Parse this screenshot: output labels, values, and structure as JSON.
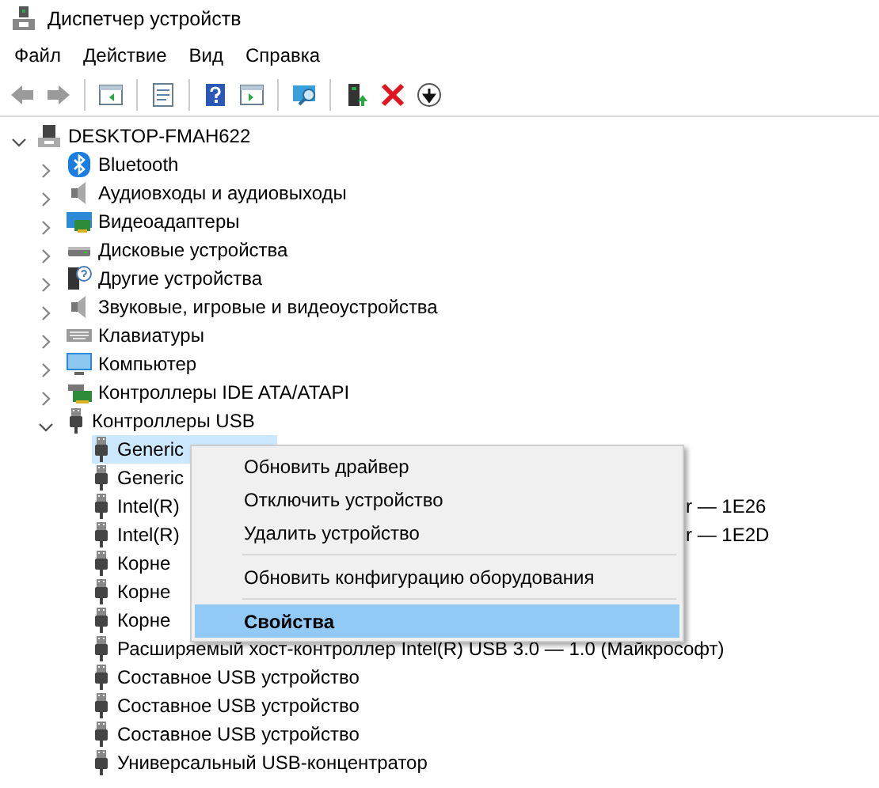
{
  "window": {
    "title": "Диспетчер устройств"
  },
  "menu_bar": [
    "Файл",
    "Действие",
    "Вид",
    "Справка"
  ],
  "toolbar": [
    {
      "kind": "back"
    },
    {
      "kind": "forward"
    },
    {
      "kind": "separator"
    },
    {
      "kind": "pane"
    },
    {
      "kind": "separator"
    },
    {
      "kind": "properties"
    },
    {
      "kind": "separator"
    },
    {
      "kind": "help"
    },
    {
      "kind": "pane-play"
    },
    {
      "kind": "separator"
    },
    {
      "kind": "scan"
    },
    {
      "kind": "separator"
    },
    {
      "kind": "enable"
    },
    {
      "kind": "delete"
    },
    {
      "kind": "download"
    }
  ],
  "tree": {
    "label": "DESKTOP-FMAH622",
    "kind": "computer-root",
    "expanded": true,
    "children": [
      {
        "label": "Bluetooth",
        "kind": "bluetooth",
        "expanded": false
      },
      {
        "label": "Аудиовходы и аудиовыходы",
        "kind": "speaker",
        "expanded": false
      },
      {
        "label": "Видеоадаптеры",
        "kind": "display",
        "expanded": false
      },
      {
        "label": "Дисковые устройства",
        "kind": "disk",
        "expanded": false
      },
      {
        "label": "Другие устройства",
        "kind": "unknown",
        "expanded": false
      },
      {
        "label": "Звуковые, игровые и видеоустройства",
        "kind": "speaker",
        "expanded": false
      },
      {
        "label": "Клавиатуры",
        "kind": "keyboard",
        "expanded": false
      },
      {
        "label": "Компьютер",
        "kind": "monitor",
        "expanded": false
      },
      {
        "label": "Контроллеры IDE ATA/ATAPI",
        "kind": "ide",
        "expanded": false
      },
      {
        "label": "Контроллеры USB",
        "kind": "usb",
        "expanded": true,
        "children": [
          {
            "label": "Generic",
            "kind": "usb",
            "selected": true
          },
          {
            "label": "Generic",
            "kind": "usb",
            "selected": false
          },
          {
            "label": "Intel(R)",
            "label_tail": "r — 1E26",
            "kind": "usb",
            "selected": false
          },
          {
            "label": "Intel(R)",
            "label_tail": "r — 1E2D",
            "kind": "usb",
            "selected": false
          },
          {
            "label": "Корне",
            "kind": "usb",
            "selected": false
          },
          {
            "label": "Корне",
            "kind": "usb",
            "selected": false
          },
          {
            "label": "Корне",
            "kind": "usb",
            "selected": false
          },
          {
            "label": "Расширяемый хост-контроллер Intel(R) USB 3.0 — 1.0 (Майкрософт)",
            "kind": "usb",
            "selected": false
          },
          {
            "label": "Составное USB устройство",
            "kind": "usb",
            "selected": false
          },
          {
            "label": "Составное USB устройство",
            "kind": "usb",
            "selected": false
          },
          {
            "label": "Составное USB устройство",
            "kind": "usb",
            "selected": false
          },
          {
            "label": "Универсальный USB-концентратор",
            "kind": "usb",
            "selected": false
          }
        ]
      }
    ]
  },
  "context_menu": {
    "items": [
      {
        "kind": "item",
        "label": "Обновить драйвер",
        "selected": false,
        "default": false
      },
      {
        "kind": "item",
        "label": "Отключить устройство",
        "selected": false,
        "default": false
      },
      {
        "kind": "item",
        "label": "Удалить устройство",
        "selected": false,
        "default": false
      },
      {
        "kind": "separator"
      },
      {
        "kind": "item",
        "label": "Обновить конфигурацию оборудования",
        "selected": false,
        "default": false
      },
      {
        "kind": "separator"
      },
      {
        "kind": "item",
        "label": "Свойства",
        "selected": true,
        "default": true
      }
    ]
  }
}
